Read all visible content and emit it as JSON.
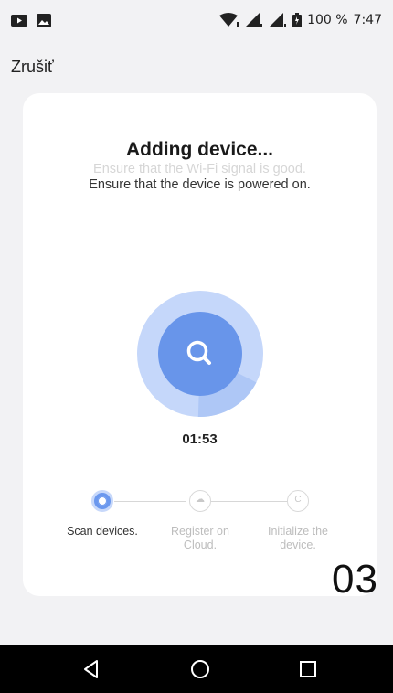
{
  "status_bar": {
    "battery": "100 %",
    "time": "7:47"
  },
  "header": {
    "cancel_label": "Zrušiť"
  },
  "card": {
    "title": "Adding device...",
    "hint_wifi": "Ensure that the Wi-Fi signal is good.",
    "hint_power": "Ensure that the device is powered on.",
    "timer": "01:53",
    "progress": 0.18,
    "steps": [
      {
        "label": "Scan devices.",
        "state": "active"
      },
      {
        "label": "Register on Cloud.",
        "state": "pending",
        "icon": "cloud-icon"
      },
      {
        "label": "Initialize the device.",
        "state": "pending",
        "icon": "c-icon"
      }
    ]
  },
  "overlay_number": "03",
  "colors": {
    "accent": "#6b98ee",
    "accent_light": "#c7d8fa",
    "background": "#f2f2f4"
  }
}
